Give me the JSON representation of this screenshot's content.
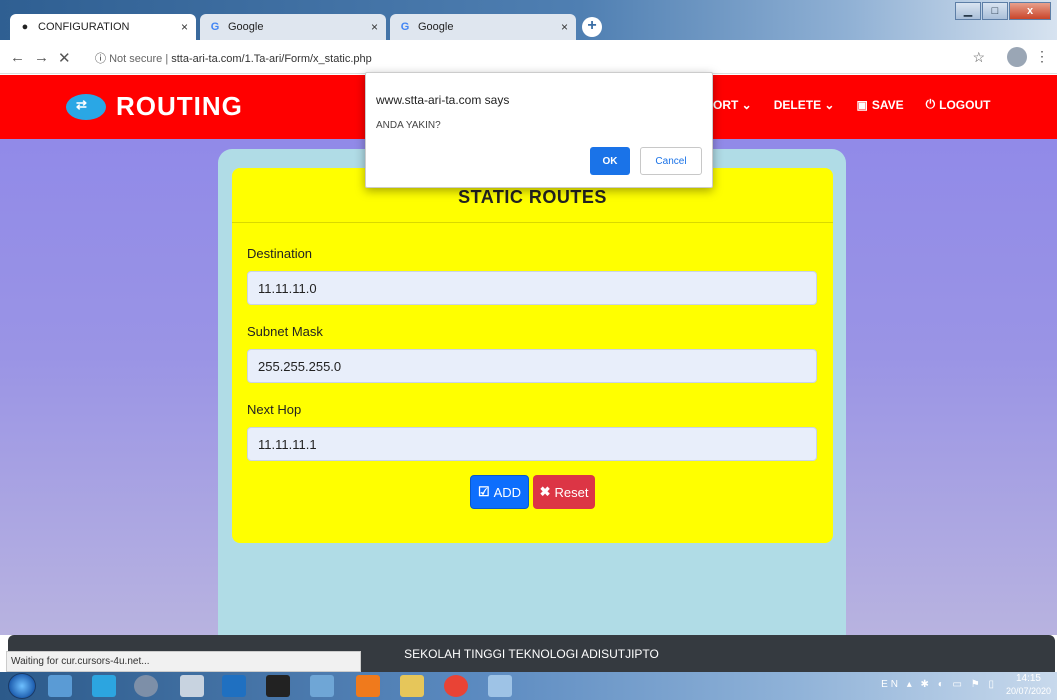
{
  "browser": {
    "tabs": [
      {
        "title": "CONFIGURATION",
        "favicon": "router-favicon",
        "active": true
      },
      {
        "title": "Google",
        "favicon": "google-icon",
        "active": false
      },
      {
        "title": "Google",
        "favicon": "google-icon",
        "active": false
      }
    ],
    "tab_close": "×",
    "new_tab": "+",
    "security": "Not secure",
    "url_path": "stta-ari-ta.com/1.Ta-ari/Form/x_static.php",
    "status": "Waiting for cur.cursors-4u.net..."
  },
  "app": {
    "brand": "ROUTING",
    "menu": [
      "PORT",
      "DELETE",
      "SAVE",
      "LOGOUT"
    ],
    "form": {
      "title": "STATIC ROUTES",
      "fields": [
        {
          "label": "Destination",
          "value": "11.11.11.0"
        },
        {
          "label": "Subnet Mask",
          "value": "255.255.255.0"
        },
        {
          "label": "Next Hop",
          "value": "11.11.11.1"
        }
      ],
      "add_label": "ADD",
      "reset_label": "Reset"
    },
    "footer": "SEKOLAH TINGGI TEKNOLOGI ADISUTJIPTO"
  },
  "dialog": {
    "title": "www.stta-ari-ta.com says",
    "message": "ANDA YAKIN?",
    "ok": "OK",
    "cancel": "Cancel"
  },
  "taskbar": {
    "lang": "EN",
    "time": "14:15",
    "date": "20/07/2020"
  },
  "colors": {
    "navbar": "#ff0000",
    "card": "#ffff00",
    "add_button": "#0d6efd",
    "reset_button": "#dc3545",
    "page_bg": "#8e87e9"
  }
}
